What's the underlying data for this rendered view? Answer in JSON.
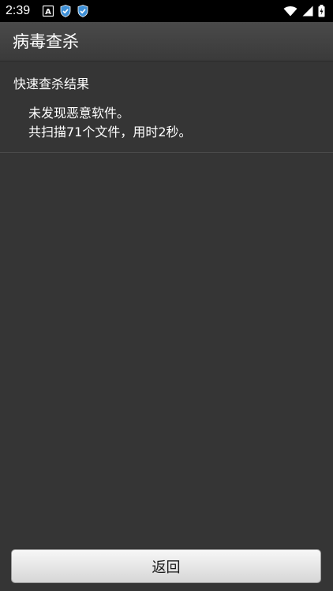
{
  "status_bar": {
    "time": "2:39",
    "left_icons": [
      "notification-a-icon",
      "shield-icon",
      "shield-icon"
    ],
    "right_icons": [
      "wifi-icon",
      "signal-icon",
      "battery-icon"
    ]
  },
  "app_bar": {
    "title": "病毒查杀"
  },
  "scan_result": {
    "header": "快速查杀结果",
    "line1": "未发现恶意软件。",
    "line2": "共扫描71个文件，用时2秒。"
  },
  "footer": {
    "back_label": "返回"
  },
  "colors": {
    "background": "#353535",
    "status_bar": "#000000",
    "shield_blue": "#3d8fd6"
  }
}
